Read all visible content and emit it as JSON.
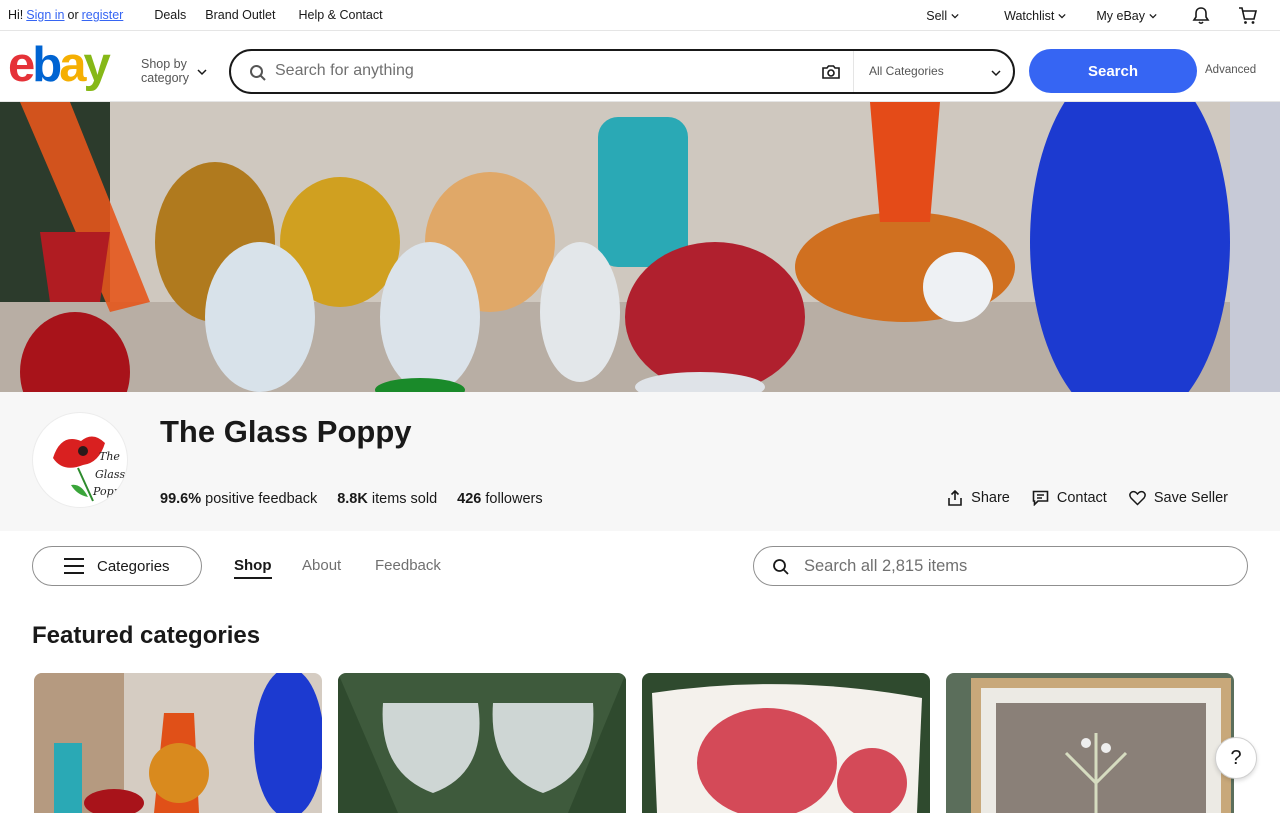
{
  "topbar": {
    "hi": "Hi!",
    "sign_in": "Sign in",
    "or": "or",
    "register": "register",
    "links": [
      "Deals",
      "Brand Outlet",
      "Help & Contact"
    ],
    "sell": "Sell",
    "watchlist": "Watchlist",
    "my_ebay": "My eBay"
  },
  "header": {
    "logo_text": "ebay",
    "shop_by_line1": "Shop by",
    "shop_by_line2": "category",
    "search_placeholder": "Search for anything",
    "category_select": "All Categories",
    "search_button": "Search",
    "advanced": "Advanced"
  },
  "store": {
    "name": "The Glass Poppy",
    "logo_text_1": "The",
    "logo_text_2": "Glass",
    "logo_text_3": "Popp",
    "feedback_value": "99.6%",
    "feedback_label": "positive feedback",
    "sold_value": "8.8K",
    "sold_label": "items sold",
    "followers_value": "426",
    "followers_label": "followers",
    "share": "Share",
    "contact": "Contact",
    "save_seller": "Save Seller"
  },
  "nav": {
    "categories": "Categories",
    "tabs": [
      "Shop",
      "About",
      "Feedback"
    ],
    "store_search_placeholder": "Search all 2,815 items"
  },
  "featured": {
    "title": "Featured categories"
  },
  "help": "?",
  "colors": {
    "accent": "#3665f3",
    "text": "#191919",
    "store_bg": "#f7f7f7"
  }
}
